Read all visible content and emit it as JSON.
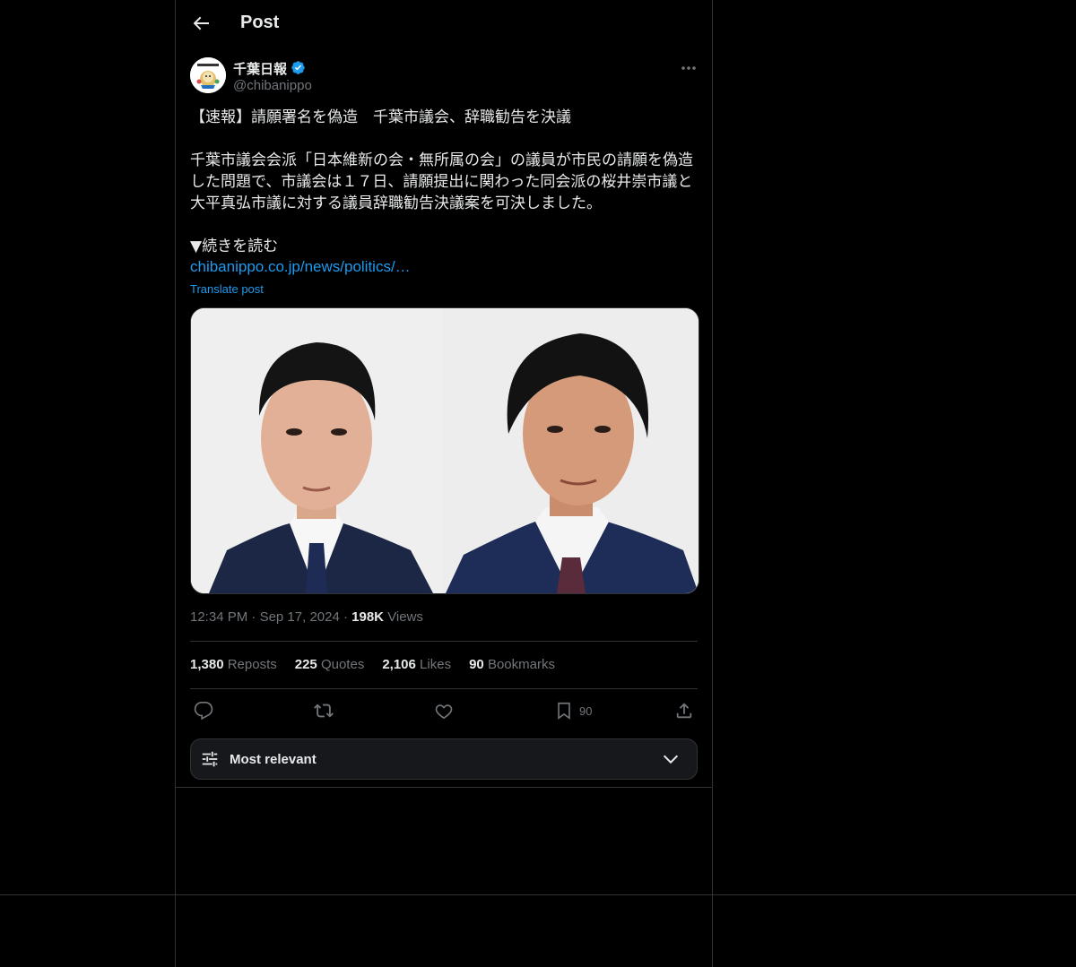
{
  "header": {
    "title": "Post"
  },
  "post": {
    "author_name": "千葉日報",
    "author_handle": "@chibanippo",
    "text": "【速報】請願署名を偽造　千葉市議会、辞職勧告を決議\n\n千葉市議会会派「日本維新の会・無所属の会」の議員が市民の請願を偽造\nした問題で、市議会は１７日、請願提出に関わった同会派の桜井崇市議と\n大平真弘市議に対する議員辞職勧告決議案を可決しました。\n\n▼続きを読む",
    "link_text": "chibanippo.co.jp/news/politics/…",
    "translate_label": "Translate post",
    "time": "12:34 PM",
    "date": "Sep 17, 2024",
    "views_count": "198K",
    "views_label": "Views"
  },
  "stats": {
    "reposts_count": "1,380",
    "reposts_label": "Reposts",
    "quotes_count": "225",
    "quotes_label": "Quotes",
    "likes_count": "2,106",
    "likes_label": "Likes",
    "bookmarks_count": "90",
    "bookmarks_label": "Bookmarks"
  },
  "actions": {
    "bookmark_count": "90"
  },
  "sort": {
    "label": "Most relevant"
  },
  "colors": {
    "accent": "#1d9bf0",
    "background": "#000000",
    "text": "#e7e9ea",
    "muted": "#71767b",
    "border": "#2f3336"
  }
}
